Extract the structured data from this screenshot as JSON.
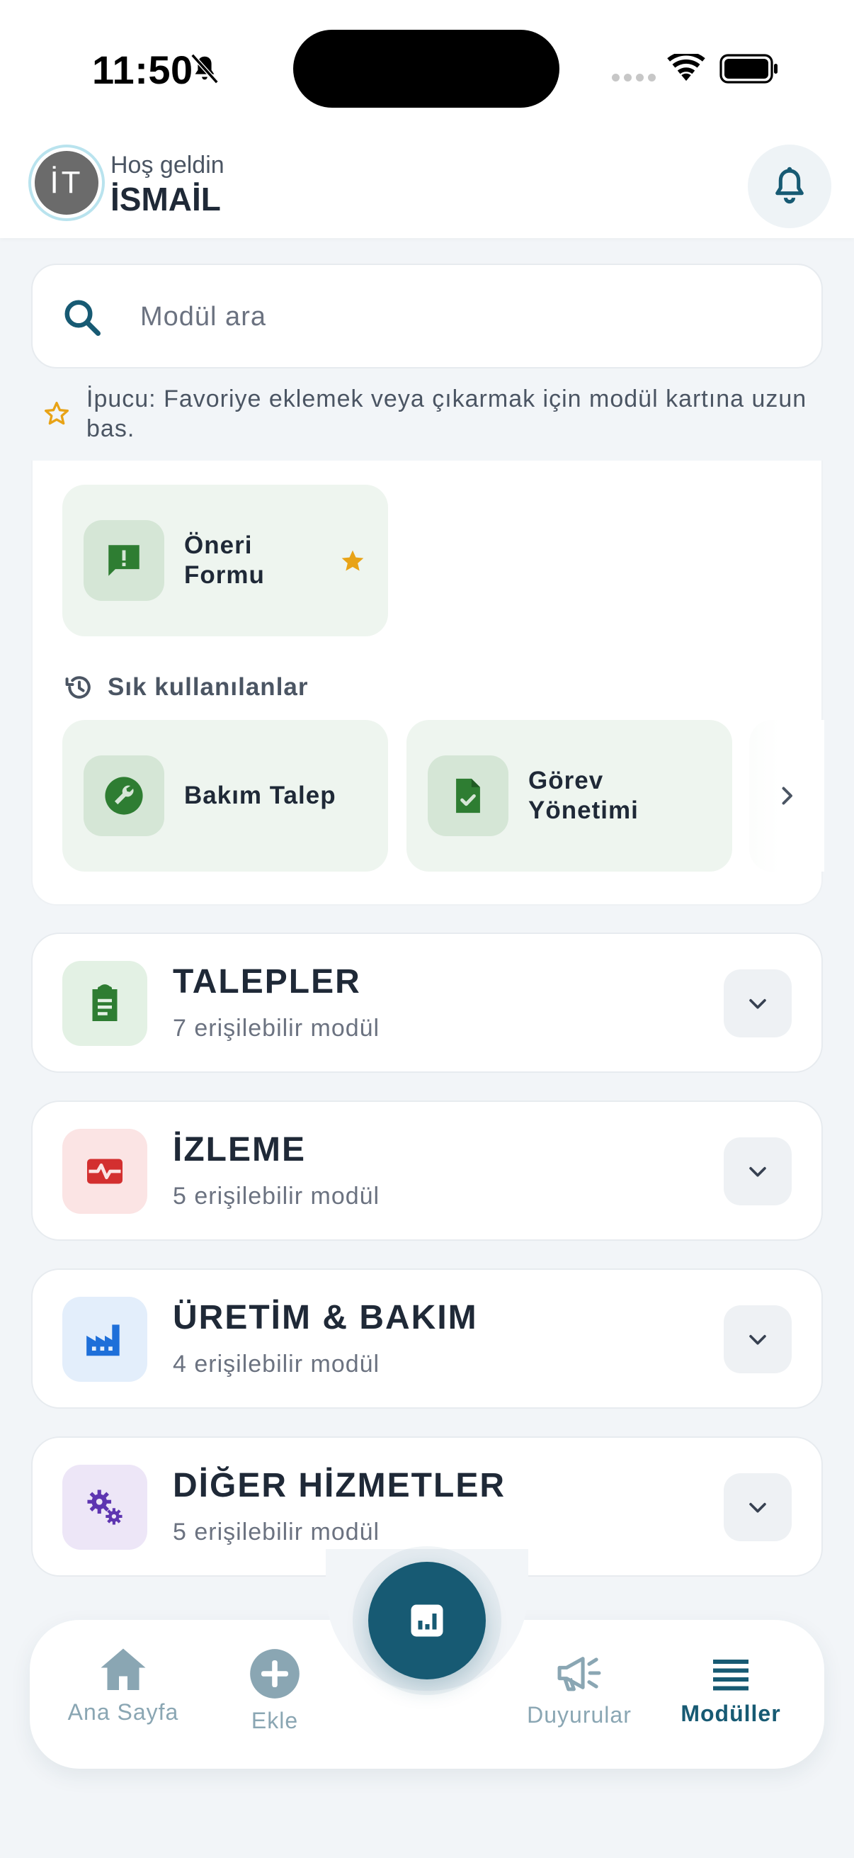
{
  "status_bar": {
    "time": "11:50"
  },
  "header": {
    "avatar_initials": "İT",
    "greeting": "Hoş geldin",
    "username": "İSMAİL"
  },
  "search": {
    "placeholder": "Modül ara"
  },
  "tip": {
    "text": "İpucu: Favoriye eklemek veya çıkarmak için modül kartına uzun bas."
  },
  "favorites": [
    {
      "label": "Öneri Formu",
      "icon": "feedback-icon",
      "favorite": true
    }
  ],
  "frequent": {
    "title": "Sık kullanılanlar",
    "items": [
      {
        "label": "Bakım Talep",
        "icon": "wrench-icon"
      },
      {
        "label": "Görev Yönetimi",
        "icon": "task-file-icon"
      }
    ]
  },
  "categories": [
    {
      "title": "TALEPLER",
      "subtitle": "7 erişilebilir modül",
      "icon": "clipboard-icon",
      "color": "#2e7d32",
      "bg": "#e3f1e4"
    },
    {
      "title": "İZLEME",
      "subtitle": "5 erişilebilir modül",
      "icon": "monitor-heart-icon",
      "color": "#d32f2f",
      "bg": "#fbe4e4"
    },
    {
      "title": "ÜRETİM & BAKIM",
      "subtitle": "4 erişilebilir modül",
      "icon": "factory-icon",
      "color": "#1e6fd9",
      "bg": "#e3eefb"
    },
    {
      "title": "DİĞER HİZMETLER",
      "subtitle": "5 erişilebilir modül",
      "icon": "gears-icon",
      "color": "#5e35b1",
      "bg": "#ede6f7"
    }
  ],
  "nav": {
    "home": "Ana Sayfa",
    "add": "Ekle",
    "announcements": "Duyurular",
    "modules": "Modüller",
    "active": "Modüller"
  },
  "colors": {
    "primary": "#175a73",
    "inactive": "#8aa6b3",
    "accent_star": "#e8a317"
  }
}
